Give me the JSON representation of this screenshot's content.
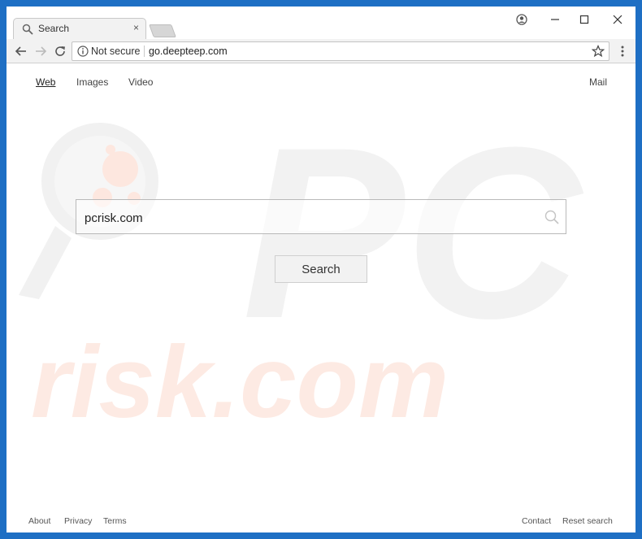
{
  "browser": {
    "tab_title": "Search",
    "tab_close": "×",
    "address": {
      "security_label": "Not secure",
      "url": "go.deepteep.com"
    }
  },
  "nav": {
    "web": "Web",
    "images": "Images",
    "video": "Video",
    "mail": "Mail"
  },
  "search": {
    "value": "pcrisk.com",
    "button_label": "Search"
  },
  "footer": {
    "left": [
      "About",
      "Privacy",
      "Terms"
    ],
    "right": [
      "Contact",
      "Reset search"
    ]
  },
  "watermark": {
    "text_top": "PC",
    "text_bottom": "risk.com"
  },
  "icons": {
    "tab": "magnifier-icon",
    "back": "back-arrow-icon",
    "forward": "forward-arrow-icon",
    "reload": "reload-icon",
    "info": "info-icon",
    "bookmark": "star-icon",
    "menu": "kebab-menu-icon",
    "account": "account-icon",
    "search": "search-icon"
  },
  "colors": {
    "frame": "#1e6fc4",
    "watermark_gray": "#f1f1f1",
    "watermark_orange": "#fde9e2"
  }
}
